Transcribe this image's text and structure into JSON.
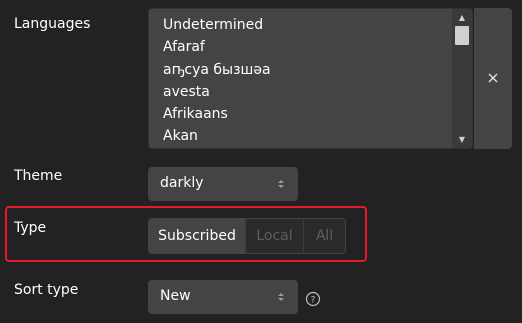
{
  "languages": {
    "label": "Languages",
    "options": [
      "Undetermined",
      "Afaraf",
      "аҧсуа бызшәа",
      "avesta",
      "Afrikaans",
      "Akan"
    ],
    "clear_icon": "close-icon"
  },
  "theme": {
    "label": "Theme",
    "value": "darkly"
  },
  "type": {
    "label": "Type",
    "options": [
      {
        "label": "Subscribed",
        "active": true
      },
      {
        "label": "Local",
        "active": false
      },
      {
        "label": "All",
        "active": false
      }
    ]
  },
  "sort_type": {
    "label": "Sort type",
    "value": "New",
    "help_icon": "question-circle-icon"
  },
  "colors": {
    "background": "#222222",
    "control": "#444444",
    "highlight": "#e8192c",
    "disabled_text": "#5e5e5e"
  }
}
